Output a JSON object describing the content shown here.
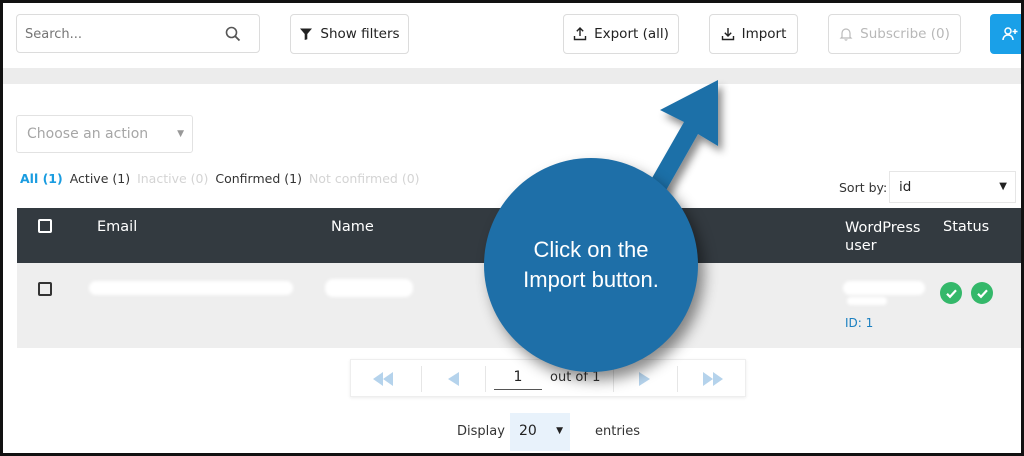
{
  "toolbar": {
    "search_placeholder": "Search...",
    "show_filters_label": "Show filters",
    "export_label": "Export (all)",
    "import_label": "Import",
    "subscribe_label": "Subscribe (0)"
  },
  "bulk_action": {
    "placeholder": "Choose an action"
  },
  "status_filters": [
    {
      "label": "All (1)",
      "state": "active"
    },
    {
      "label": "Active (1)",
      "state": "normal"
    },
    {
      "label": "Inactive (0)",
      "state": "disabled"
    },
    {
      "label": "Confirmed (1)",
      "state": "normal"
    },
    {
      "label": "Not confirmed (0)",
      "state": "disabled"
    }
  ],
  "sort": {
    "label": "Sort by:",
    "value": "id"
  },
  "table": {
    "headers": {
      "email": "Email",
      "name": "Name",
      "wp_user": "WordPress user",
      "status": "Status"
    },
    "rows": [
      {
        "wp_user_id": "ID: 1"
      }
    ]
  },
  "pagination": {
    "current_page": "1",
    "out_of": "out of 1"
  },
  "display": {
    "label": "Display",
    "value": "20",
    "suffix": "entries"
  },
  "callout": {
    "text": "Click on the Import button."
  },
  "colors": {
    "accent": "#1aa0e8",
    "header_bg": "#333a40",
    "callout_bg": "#1e6fa8",
    "status_ok": "#34b86a"
  }
}
